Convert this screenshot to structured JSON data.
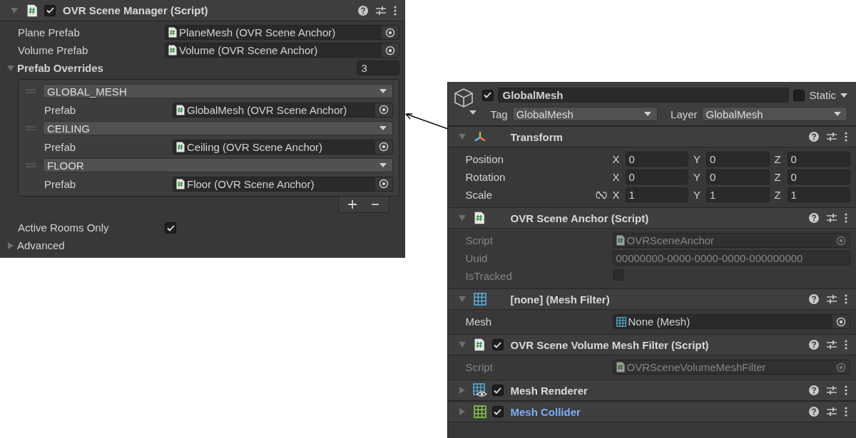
{
  "inspector_left": {
    "component": {
      "title": "OVR Scene Manager (Script)",
      "kind": "script",
      "expanded": true,
      "enabled": true
    },
    "fields": [
      {
        "kind": "script_object",
        "label": "Plane Prefab",
        "value": "PlaneMesh (OVR Scene Anchor)",
        "disabled": false
      },
      {
        "kind": "script_object",
        "label": "Volume Prefab",
        "value": "Volume (OVR Scene Anchor)",
        "disabled": false
      }
    ],
    "overrides": {
      "label": "Prefab Overrides",
      "expanded": true,
      "count": "3",
      "items": [
        {
          "type": "GLOBAL_MESH",
          "label": "Prefab",
          "value": "GlobalMesh (OVR Scene Anchor)"
        },
        {
          "type": "CEILING",
          "label": "Prefab",
          "value": "Ceiling (OVR Scene Anchor)"
        },
        {
          "type": "FLOOR",
          "label": "Prefab",
          "value": "Floor (OVR Scene Anchor)"
        }
      ]
    },
    "active_rooms_only": {
      "label": "Active Rooms Only",
      "checked": true
    },
    "advanced": {
      "label": "Advanced",
      "expanded": false
    }
  },
  "inspector_right": {
    "game_object": {
      "active": true,
      "name": "GlobalMesh",
      "static": {
        "label": "Static",
        "checked": false
      },
      "tag": {
        "label": "Tag",
        "value": "GlobalMesh"
      },
      "layer": {
        "label": "Layer",
        "value": "GlobalMesh"
      }
    },
    "components": [
      {
        "title": "Transform",
        "kind": "transform",
        "expanded": true,
        "highlighted": false,
        "rows": [
          {
            "kind": "vector",
            "label": "Position",
            "axes": [
              {
                "axis": "X",
                "value": "0"
              },
              {
                "axis": "Y",
                "value": "0"
              },
              {
                "axis": "Z",
                "value": "0"
              }
            ]
          },
          {
            "kind": "vector",
            "label": "Rotation",
            "axes": [
              {
                "axis": "X",
                "value": "0"
              },
              {
                "axis": "Y",
                "value": "0"
              },
              {
                "axis": "Z",
                "value": "0"
              }
            ]
          },
          {
            "kind": "scale",
            "label": "Scale",
            "axes": [
              {
                "axis": "X",
                "value": "1"
              },
              {
                "axis": "Y",
                "value": "1"
              },
              {
                "axis": "Z",
                "value": "1"
              }
            ]
          }
        ]
      },
      {
        "title": "OVR Scene Anchor (Script)",
        "kind": "script",
        "expanded": true,
        "highlighted": false,
        "rows": [
          {
            "kind": "script_object",
            "label": "Script",
            "value": "OVRSceneAnchor",
            "disabled": true
          },
          {
            "kind": "text",
            "label": "Uuid",
            "value": "00000000-0000-0000-0000-000000000",
            "disabled": true
          },
          {
            "kind": "checkbox",
            "label": "IsTracked",
            "checked": false,
            "disabled": true
          }
        ]
      },
      {
        "title": "[none] (Mesh Filter)",
        "kind": "mesh",
        "expanded": true,
        "highlighted": false,
        "rows": [
          {
            "kind": "mesh_object",
            "label": "Mesh",
            "value": "None (Mesh)",
            "disabled": false
          }
        ]
      },
      {
        "title": "OVR Scene Volume Mesh Filter (Script)",
        "kind": "script",
        "enabled": true,
        "expanded": true,
        "highlighted": false,
        "rows": [
          {
            "kind": "script_object",
            "label": "Script",
            "value": "OVRSceneVolumeMeshFilter",
            "disabled": true
          }
        ]
      },
      {
        "title": "Mesh Renderer",
        "kind": "renderer",
        "enabled": true,
        "expanded": false,
        "highlighted": false
      },
      {
        "title": "Mesh Collider",
        "kind": "collider",
        "enabled": true,
        "expanded": false,
        "highlighted": true
      }
    ]
  }
}
